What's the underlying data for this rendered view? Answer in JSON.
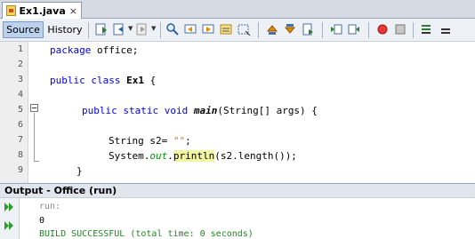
{
  "editor_tab": {
    "title": "Ex1.java",
    "close": "×"
  },
  "toolbar": {
    "source_label": "Source",
    "history_label": "History"
  },
  "line_numbers": [
    "1",
    "2",
    "3",
    "4",
    "5",
    "6",
    "7",
    "8",
    "9"
  ],
  "code": {
    "l1_kw": "package",
    "l1_rest": " office;",
    "l3_kw1": "public",
    "l3_kw2": " class",
    "l3_cls": " Ex1",
    "l3_rest": " {",
    "l5_kw": "public static void",
    "l5_method": "main",
    "l5_rest": "(String[] args) {",
    "l7_pre": "String s2= ",
    "l7_str": "\"\"",
    "l7_post": ";",
    "l8_pre": "System.",
    "l8_fld": "out",
    "l8_dot": ".",
    "l8_call": "println",
    "l8_post": "(s2.length());",
    "l9": "}"
  },
  "output": {
    "header": "Output - Office (run)",
    "lines": [
      "run:",
      "0",
      "BUILD SUCCESSFUL (total time: 0 seconds)"
    ]
  }
}
